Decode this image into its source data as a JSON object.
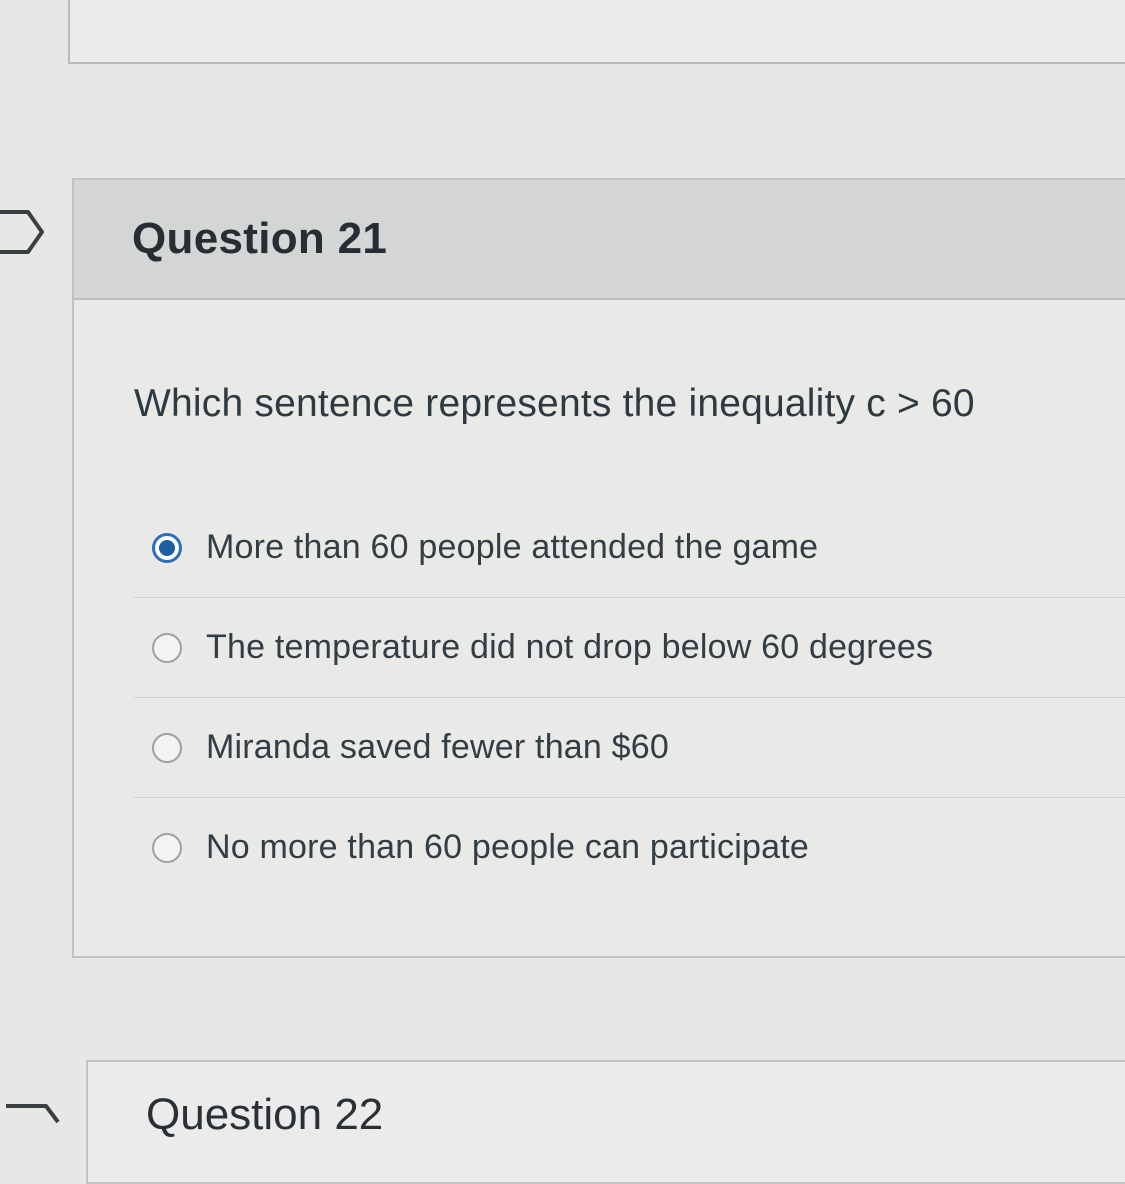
{
  "question": {
    "title": "Question 21",
    "prompt": "Which sentence represents the inequality c > 60",
    "answers": [
      {
        "label": "More than 60 people attended the game",
        "selected": true
      },
      {
        "label": "The temperature did not drop below 60 degrees",
        "selected": false
      },
      {
        "label": "Miranda saved fewer than $60",
        "selected": false
      },
      {
        "label": "No more than 60 people can participate",
        "selected": false
      }
    ]
  },
  "next_question": {
    "title": "Question 22"
  },
  "colors": {
    "accent": "#1f5e9f",
    "header_bg": "#d3d6d4",
    "page_bg": "#e7e8e6"
  },
  "icons": {
    "flag": "flag-outline-icon"
  }
}
